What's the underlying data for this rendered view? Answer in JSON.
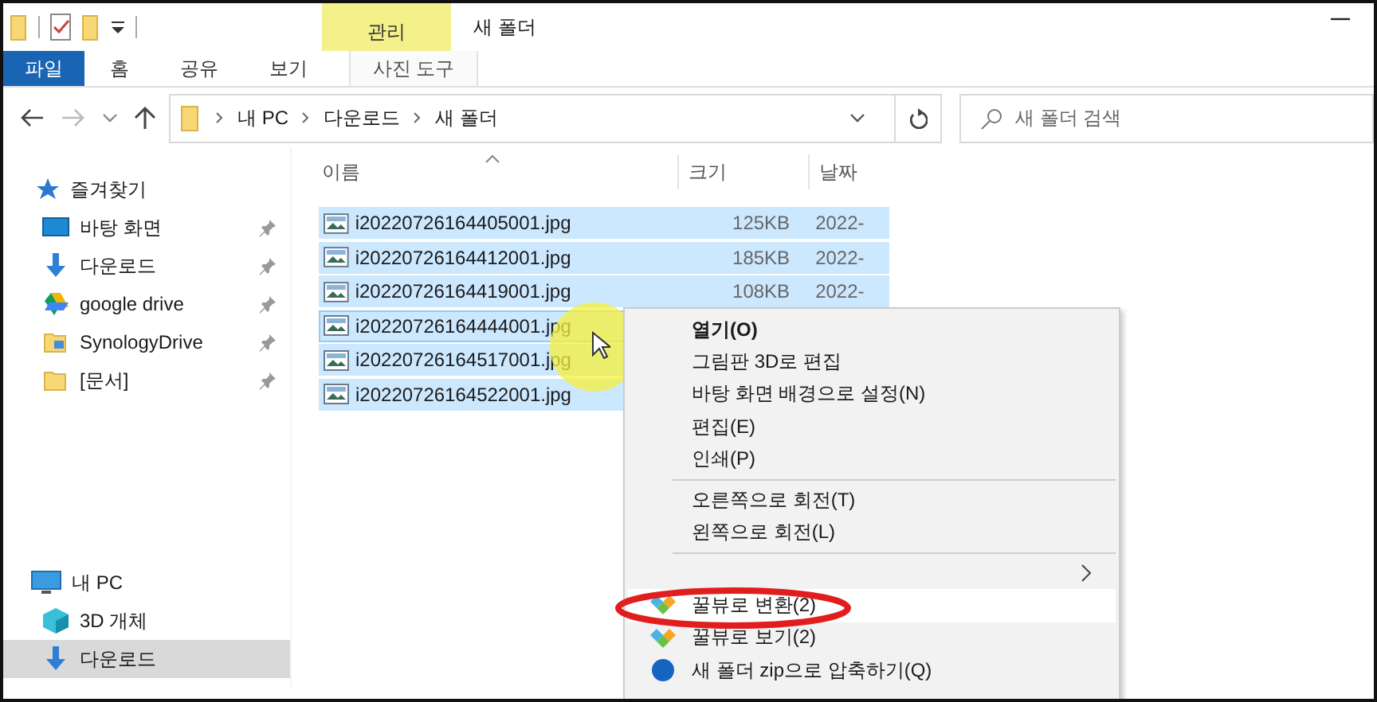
{
  "title_bar": {
    "context_tab": "관리",
    "title": "새 폴더"
  },
  "ribbon_tabs": [
    {
      "label": "파일",
      "kind": "file",
      "selected": false
    },
    {
      "label": "홈",
      "kind": "tab",
      "selected": false
    },
    {
      "label": "공유",
      "kind": "tab",
      "selected": false
    },
    {
      "label": "보기",
      "kind": "tab",
      "selected": false
    },
    {
      "label": "사진 도구",
      "kind": "context",
      "selected": false
    }
  ],
  "address_bar": {
    "path": [
      "내 PC",
      "다운로드",
      "새 폴더"
    ]
  },
  "search": {
    "placeholder": "새 폴더 검색"
  },
  "sidebar": {
    "sections": [
      {
        "label": "즐겨찾기",
        "kind": "star",
        "items": [
          {
            "label": "바탕 화면",
            "kind": "desktop",
            "pinned": true,
            "selected": false
          },
          {
            "label": "다운로드",
            "kind": "download",
            "pinned": true,
            "selected": false
          },
          {
            "label": "google drive",
            "kind": "gdrive",
            "pinned": true,
            "selected": false
          },
          {
            "label": "SynologyDrive",
            "kind": "synology",
            "pinned": true,
            "selected": false
          },
          {
            "label": "[문서]",
            "kind": "folder",
            "pinned": true,
            "selected": false
          }
        ]
      },
      {
        "label": "내 PC",
        "kind": "pc",
        "items": [
          {
            "label": "3D 개체",
            "kind": "cube",
            "pinned": false,
            "selected": false
          },
          {
            "label": "다운로드",
            "kind": "download",
            "pinned": false,
            "selected": true
          }
        ]
      }
    ]
  },
  "columns": [
    {
      "label": "이름",
      "sorted": true
    },
    {
      "label": "크기",
      "sorted": false
    },
    {
      "label": "날짜",
      "sorted": false
    }
  ],
  "files": [
    {
      "name": "i20220726164405001.jpg",
      "size": "125KB",
      "date": "2022-",
      "selected": true,
      "focused": false
    },
    {
      "name": "i20220726164412001.jpg",
      "size": "185KB",
      "date": "2022-",
      "selected": true,
      "focused": false
    },
    {
      "name": "i20220726164419001.jpg",
      "size": "108KB",
      "date": "2022-",
      "selected": true,
      "focused": false
    },
    {
      "name": "i20220726164444001.jpg",
      "selected": true,
      "focused": true
    },
    {
      "name": "i20220726164517001.jpg",
      "selected": true,
      "focused": false
    },
    {
      "name": "i20220726164522001.jpg",
      "selected": true,
      "focused": false
    }
  ],
  "context_menu": {
    "items": [
      {
        "kind": "item",
        "label": "열기(O)",
        "bold": true,
        "highlighted": false
      },
      {
        "kind": "item",
        "label": "그림판 3D로 편집",
        "bold": false,
        "highlighted": false
      },
      {
        "kind": "item",
        "label": "바탕 화면 배경으로 설정(N)",
        "bold": false,
        "highlighted": false
      },
      {
        "kind": "item",
        "label": "편집(E)",
        "bold": false,
        "highlighted": false
      },
      {
        "kind": "item",
        "label": "인쇄(P)",
        "bold": false,
        "highlighted": false
      },
      {
        "kind": "separator"
      },
      {
        "kind": "item",
        "label": "오른쪽으로 회전(T)",
        "bold": false,
        "highlighted": false
      },
      {
        "kind": "item",
        "label": "왼쪽으로 회전(L)",
        "bold": false,
        "highlighted": false
      },
      {
        "kind": "separator"
      },
      {
        "kind": "submenu",
        "highlighted": false
      },
      {
        "kind": "plugin",
        "label": "꿀뷰로 변환(2)",
        "bold": false,
        "highlighted": true
      },
      {
        "kind": "plugin",
        "label": "꿀뷰로 보기(2)",
        "bold": false,
        "highlighted": false
      },
      {
        "kind": "archive",
        "label": "새 폴더 zip으로 압축하기(Q)",
        "bold": false,
        "highlighted": false
      }
    ]
  }
}
